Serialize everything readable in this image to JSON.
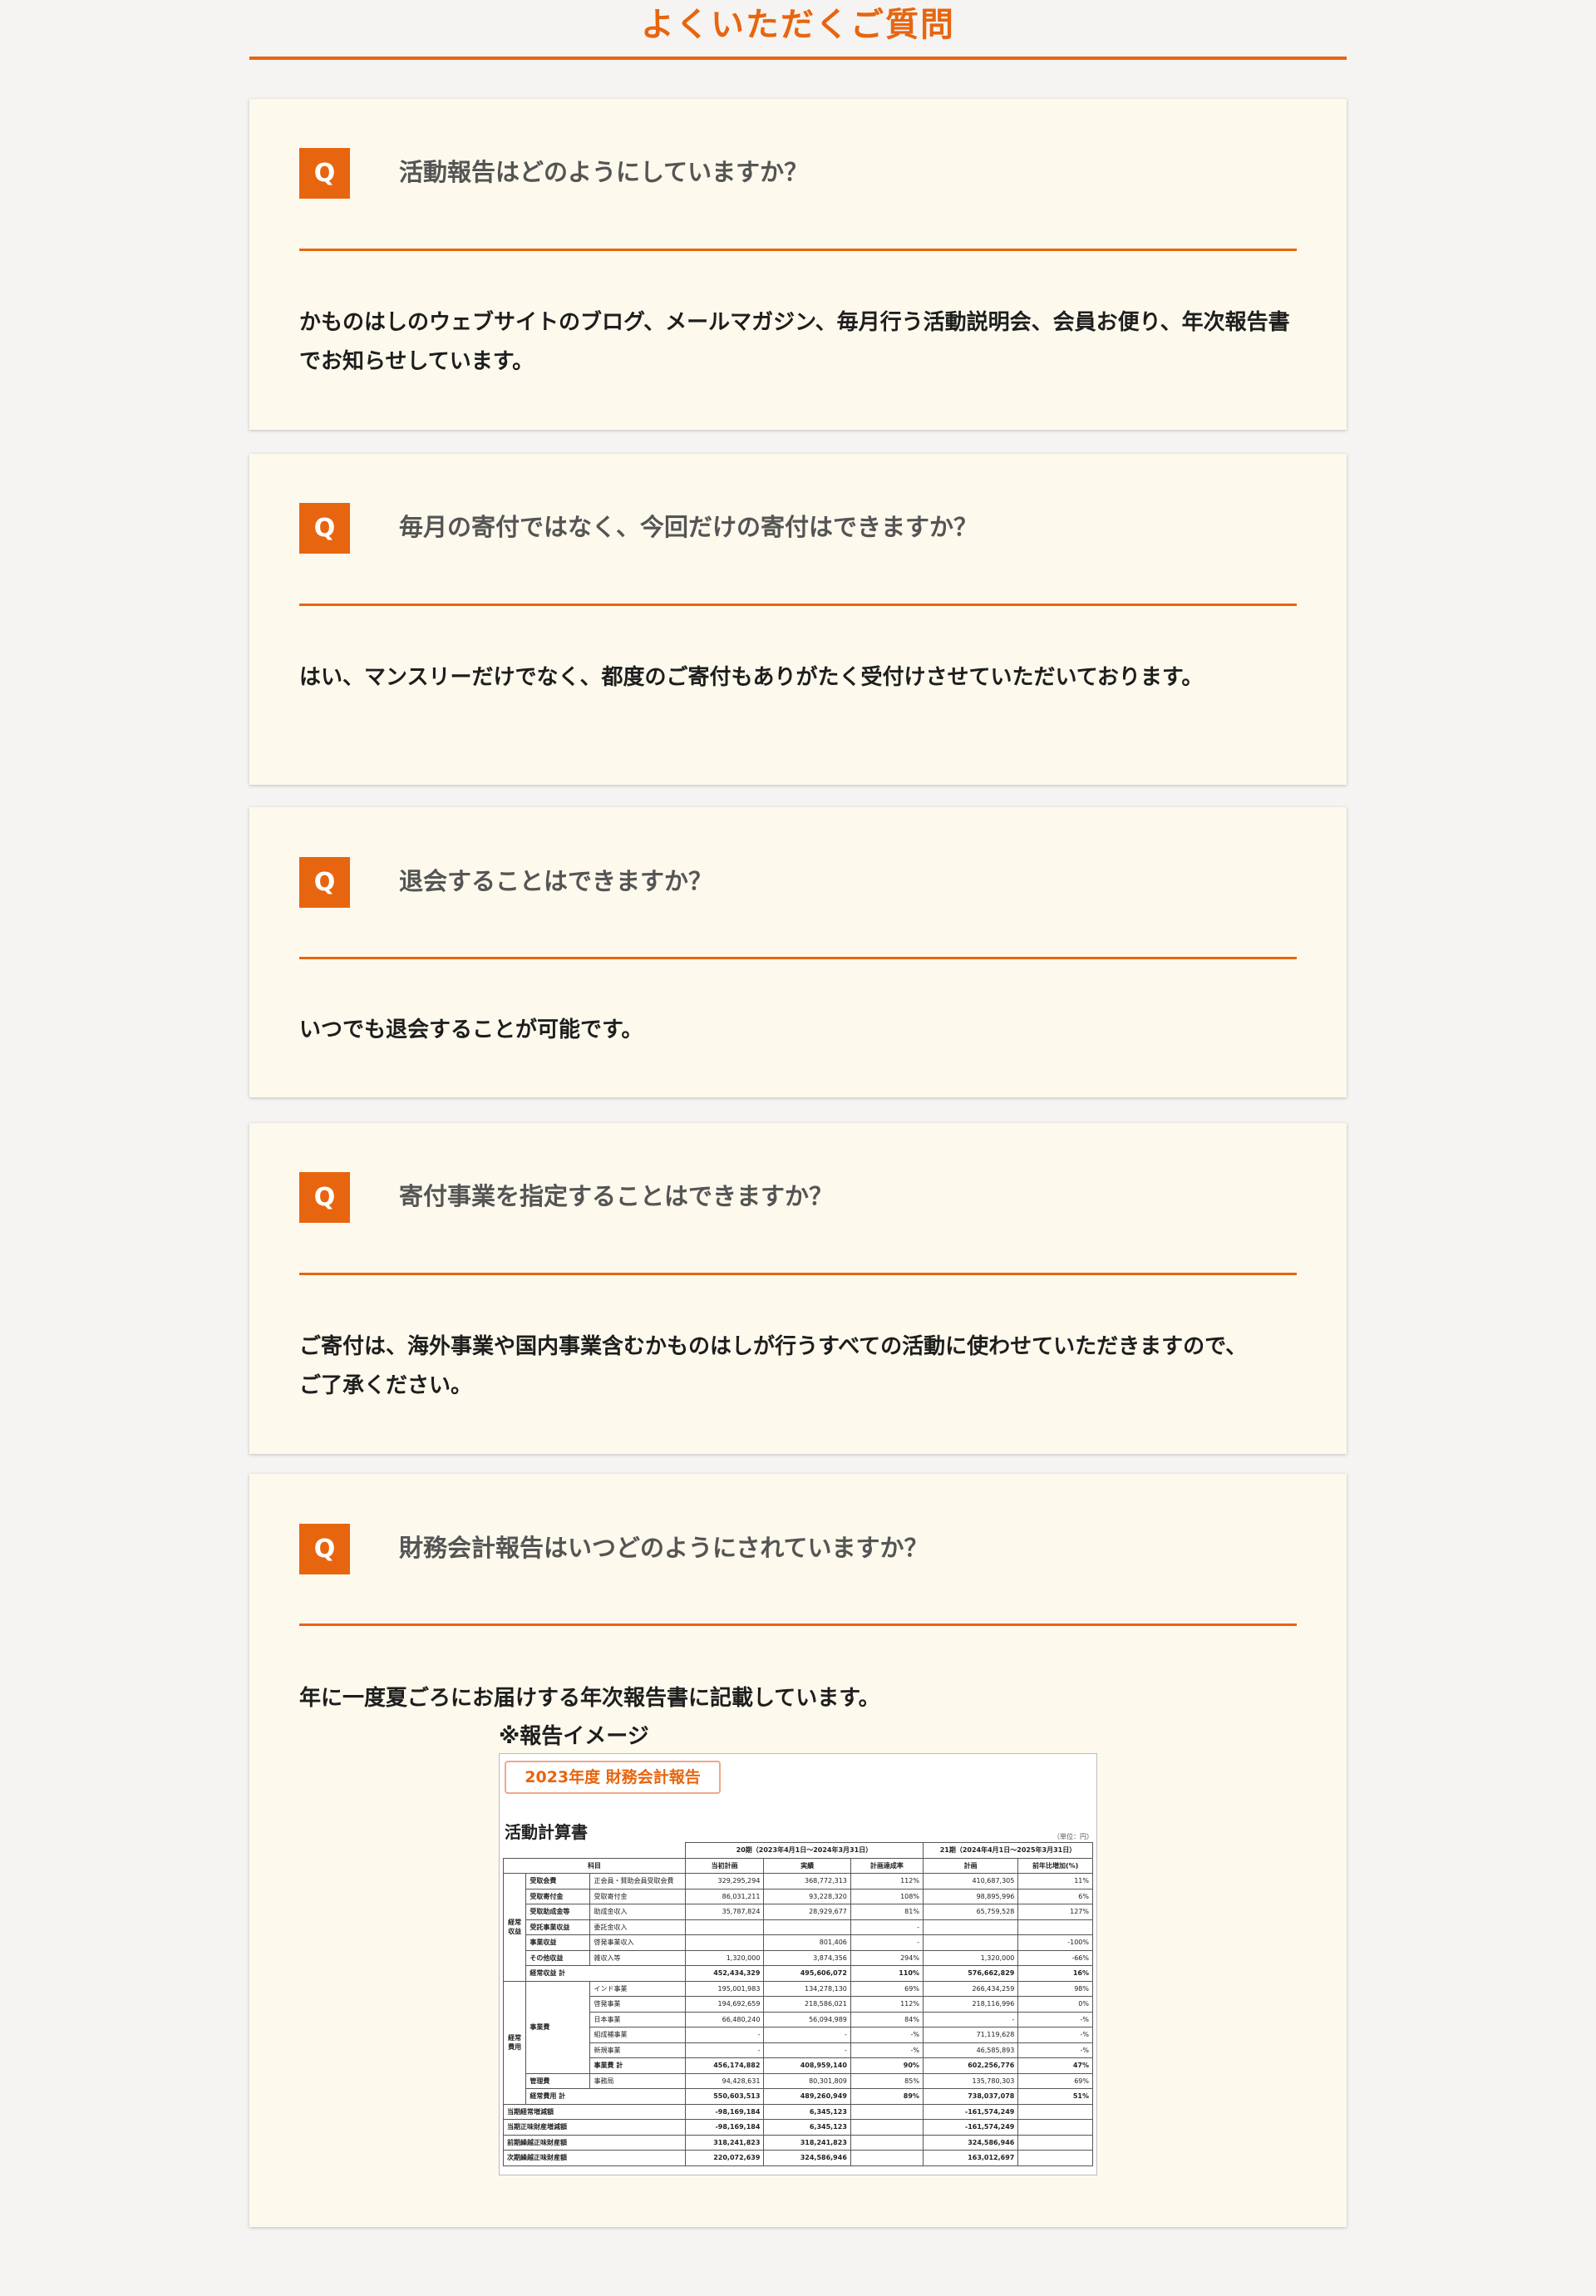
{
  "page": {
    "title": "よくいただくご質問"
  },
  "faq": [
    {
      "question": "活動報告はどのようにしていますか？",
      "answer_lines": [
        "かものはしのウェブサイトのブログ、メールマガジン、毎月行う活動説明会、会員お便り、年次報告書",
        "でお知らせしています。"
      ]
    },
    {
      "question": "毎月の寄付ではなく、今回だけの寄付はできますか？",
      "answer_lines": [
        "はい、マンスリーだけでなく、都度のご寄付もありがたく受付けさせていただいております。"
      ]
    },
    {
      "question": "退会することはできますか？",
      "answer_lines": [
        "いつでも退会することが可能です。"
      ]
    },
    {
      "question": "寄付事業を指定することはできますか？",
      "answer_lines": [
        "ご寄付は、海外事業や国内事業含むかものはしが行うすべての活動に使わせていただきますので、",
        "ご了承ください。"
      ]
    },
    {
      "question": "財務会計報告はいつどのようにされていますか？",
      "answer_lines": [
        "年に一度夏ごろにお届けする年次報告書に記載しています。"
      ]
    }
  ],
  "q_badge": "Q",
  "report": {
    "note": "※報告イメージ",
    "badge": "2023年度 財務会計報告",
    "heading": "活動計算書",
    "unit": "（単位：円）",
    "period20": "20期（2023年4月1日〜2024年3月31日）",
    "period21": "21期（2024年4月1日〜2025年3月31日）",
    "headers": [
      "科目",
      "当初計画",
      "実績",
      "計画達成率",
      "計画",
      "前年比増加(%)"
    ],
    "group_income": "経常収益",
    "group_expense": "経常費用",
    "income_rows": [
      [
        "受取会費",
        "正会員・賛助会員受取会費",
        "329,295,294",
        "368,772,313",
        "112%",
        "410,687,305",
        "11%"
      ],
      [
        "受取寄付金",
        "受取寄付金",
        "86,031,211",
        "93,228,320",
        "108%",
        "98,895,996",
        "6%"
      ],
      [
        "受取助成金等",
        "助成金収入",
        "35,787,824",
        "28,929,677",
        "81%",
        "65,759,528",
        "127%"
      ],
      [
        "受託事業収益",
        "委託金収入",
        "",
        "",
        "-",
        "",
        ""
      ],
      [
        "事業収益",
        "啓発事業収入",
        "",
        "801,406",
        "-",
        "",
        "-100%"
      ],
      [
        "その他収益",
        "雑収入等",
        "1,320,000",
        "3,874,356",
        "294%",
        "1,320,000",
        "-66%"
      ]
    ],
    "income_total": [
      "経常収益 計",
      "452,434,329",
      "495,606,072",
      "110%",
      "576,662,829",
      "16%"
    ],
    "project_label": "事業費",
    "project_rows": [
      [
        "インド事業",
        "195,001,983",
        "134,278,130",
        "69%",
        "266,434,259",
        "98%"
      ],
      [
        "啓発事業",
        "194,692,659",
        "218,586,021",
        "112%",
        "218,116,996",
        "0%"
      ],
      [
        "日本事業",
        "66,480,240",
        "56,094,989",
        "84%",
        "-",
        "-%"
      ],
      [
        "組成補事業",
        "-",
        "-",
        "-%",
        "71,119,628",
        "-%"
      ],
      [
        "新規事業",
        "-",
        "-",
        "-%",
        "46,585,893",
        "-%"
      ]
    ],
    "project_total": [
      "事業費 計",
      "456,174,882",
      "408,959,140",
      "90%",
      "602,256,776",
      "47%"
    ],
    "admin_row": [
      "管理費",
      "事務局",
      "94,428,631",
      "80,301,809",
      "85%",
      "135,780,303",
      "69%"
    ],
    "expense_total": [
      "経常費用 計",
      "550,603,513",
      "489,260,949",
      "89%",
      "738,037,078",
      "51%"
    ],
    "bottom_rows": [
      [
        "当期経常増減額",
        "-98,169,184",
        "6,345,123",
        "",
        "-161,574,249",
        ""
      ],
      [
        "当期正味財産増減額",
        "-98,169,184",
        "6,345,123",
        "",
        "-161,574,249",
        ""
      ],
      [
        "前期繰越正味財産額",
        "318,241,823",
        "318,241,823",
        "",
        "324,586,946",
        ""
      ],
      [
        "次期繰越正味財産額",
        "220,072,639",
        "324,586,946",
        "",
        "163,012,697",
        ""
      ]
    ]
  },
  "colors": {
    "accent": "#e8650f",
    "card_bg": "#fdfaed",
    "page_bg": "#f5f4f2"
  }
}
